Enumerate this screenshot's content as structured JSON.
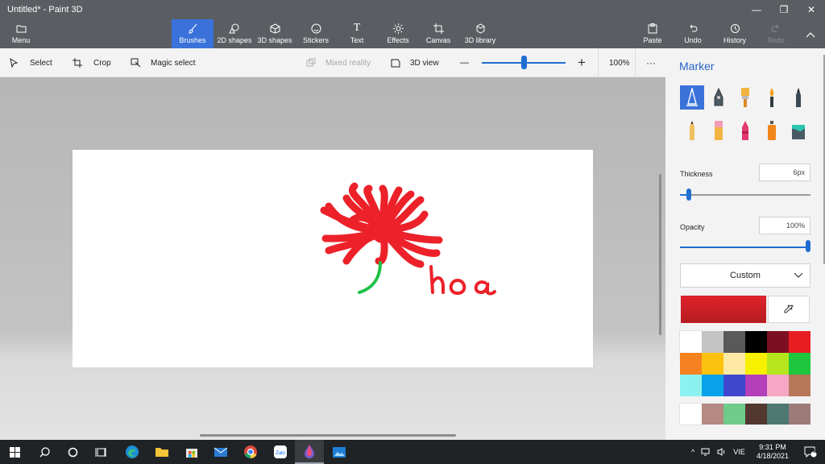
{
  "window": {
    "title": "Untitled* - Paint 3D",
    "minimize_glyph": "—",
    "maximize_glyph": "❐",
    "close_glyph": "✕"
  },
  "ribbon": {
    "menu": "Menu",
    "brushes": "Brushes",
    "shapes2d": "2D shapes",
    "shapes3d": "3D shapes",
    "stickers": "Stickers",
    "text": "Text",
    "effects": "Effects",
    "canvas": "Canvas",
    "library3d": "3D library",
    "paste": "Paste",
    "undo": "Undo",
    "history": "History",
    "redo": "Redo"
  },
  "toolbar": {
    "select": "Select",
    "crop": "Crop",
    "magic_select": "Magic select",
    "mixed_reality": "Mixed reality",
    "view3d": "3D view",
    "zoom_minus": "—",
    "zoom_plus": "+",
    "zoom_value": "100%",
    "more": "···"
  },
  "canvas": {
    "word": "hoa"
  },
  "panel": {
    "title": "Marker",
    "brushes": [
      "marker",
      "calligraphy-pen",
      "oil-brush",
      "watercolor",
      "pixel-pen",
      "pencil",
      "eraser",
      "crayon",
      "spray-can",
      "fill"
    ],
    "thickness_label": "Thickness",
    "thickness_value": "6px",
    "opacity_label": "Opacity",
    "opacity_value": "100%",
    "color_mode": "Custom",
    "current_color": "#e2222a",
    "palette": [
      "#ffffff",
      "#c4c4c4",
      "#595959",
      "#000000",
      "#7d1020",
      "#e81d24",
      "#f58220",
      "#fdc20f",
      "#fde9a3",
      "#f7f000",
      "#b5e61d",
      "#1ec63e",
      "#8cf2f0",
      "#08a2e8",
      "#3f48cc",
      "#b33fbb",
      "#f5a7c4",
      "#b7785a"
    ],
    "custom_colors": [
      "#ffffff",
      "#b48a82",
      "#6fcb8a",
      "#53382f",
      "#4f7873",
      "#9c7b79"
    ]
  },
  "taskbar": {
    "lang": "VIE",
    "time": "9:31 PM",
    "date": "4/18/2021",
    "notif_count": "1"
  }
}
